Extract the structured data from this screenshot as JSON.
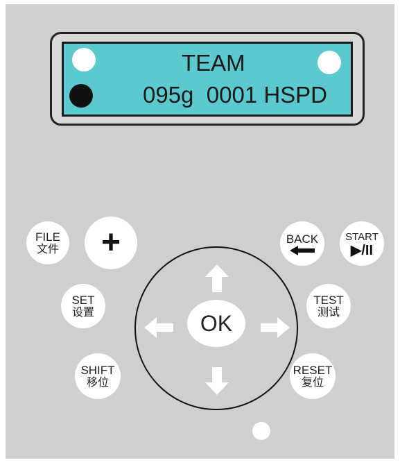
{
  "display": {
    "line1": "TEAM",
    "line2": "095g  0001 HSPD"
  },
  "buttons": {
    "file": {
      "en": "FILE",
      "zh": "文件"
    },
    "plus": {
      "symbol": "+"
    },
    "back": {
      "en": "BACK"
    },
    "start": {
      "en": "START",
      "symbol": "▶/II"
    },
    "set": {
      "en": "SET",
      "zh": "设置"
    },
    "test": {
      "en": "TEST",
      "zh": "测试"
    },
    "ok": {
      "label": "OK"
    },
    "shift": {
      "en": "SHIFT",
      "zh": "移位"
    },
    "reset": {
      "en": "RESET",
      "zh": "复位"
    }
  },
  "colors": {
    "panel": "#cfcfcf",
    "lcd": "#5cc8cf",
    "button": "#ffffff"
  }
}
